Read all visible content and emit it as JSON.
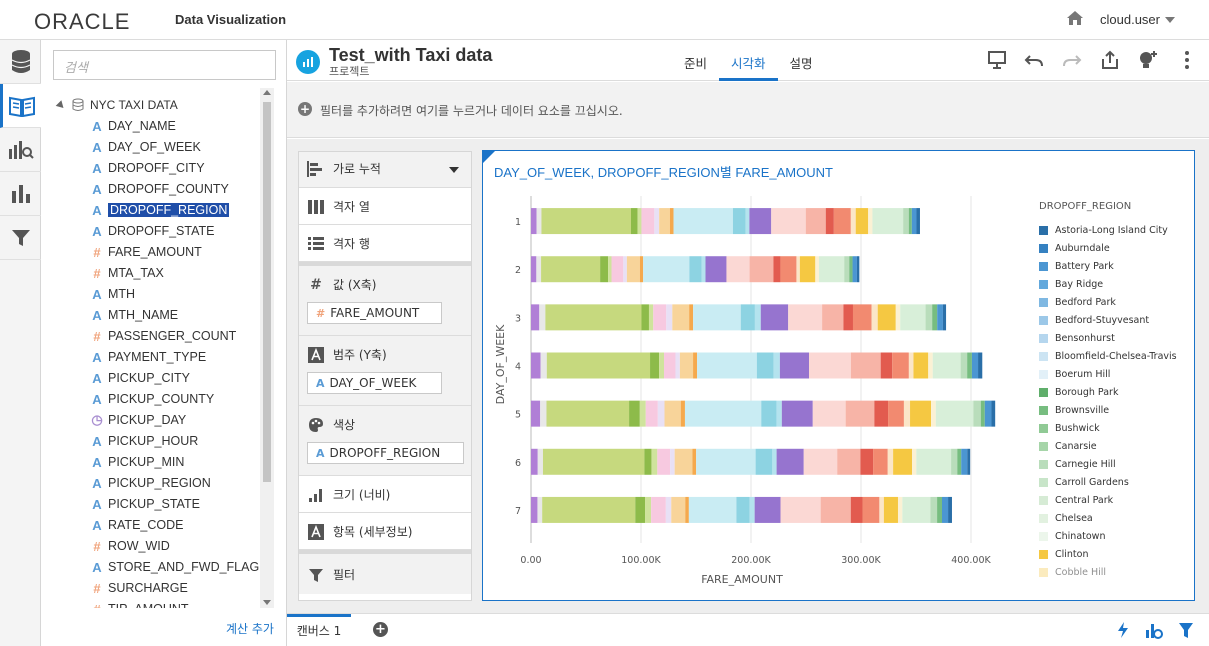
{
  "header": {
    "logo": "ORACLE",
    "app_title": "Data Visualization",
    "user_name": "cloud.user"
  },
  "data_panel": {
    "search_placeholder": "검색",
    "dataset_name": "NYC TAXI DATA",
    "items": [
      {
        "label": "DAY_NAME",
        "type": "A"
      },
      {
        "label": "DAY_OF_WEEK",
        "type": "A"
      },
      {
        "label": "DROPOFF_CITY",
        "type": "A"
      },
      {
        "label": "DROPOFF_COUNTY",
        "type": "A"
      },
      {
        "label": "DROPOFF_REGION",
        "type": "A"
      },
      {
        "label": "DROPOFF_STATE",
        "type": "A"
      },
      {
        "label": "FARE_AMOUNT",
        "type": "#"
      },
      {
        "label": "MTA_TAX",
        "type": "#"
      },
      {
        "label": "MTH",
        "type": "A"
      },
      {
        "label": "MTH_NAME",
        "type": "A"
      },
      {
        "label": "PASSENGER_COUNT",
        "type": "#"
      },
      {
        "label": "PAYMENT_TYPE",
        "type": "A"
      },
      {
        "label": "PICKUP_CITY",
        "type": "A"
      },
      {
        "label": "PICKUP_COUNTY",
        "type": "A"
      },
      {
        "label": "PICKUP_DAY",
        "type": "clock"
      },
      {
        "label": "PICKUP_HOUR",
        "type": "A"
      },
      {
        "label": "PICKUP_MIN",
        "type": "A"
      },
      {
        "label": "PICKUP_REGION",
        "type": "A"
      },
      {
        "label": "PICKUP_STATE",
        "type": "A"
      },
      {
        "label": "RATE_CODE",
        "type": "A"
      },
      {
        "label": "ROW_WID",
        "type": "#"
      },
      {
        "label": "STORE_AND_FWD_FLAG",
        "type": "A"
      },
      {
        "label": "SURCHARGE",
        "type": "#"
      },
      {
        "label": "TIP_AMOUNT",
        "type": "#"
      }
    ],
    "selected_item": "DROPOFF_REGION",
    "add_calc": "계산 추가"
  },
  "project": {
    "title": "Test_with Taxi data",
    "subtitle": "프로젝트",
    "tabs": [
      "준비",
      "시각화",
      "설명"
    ],
    "active_tab": "시각화"
  },
  "filter_bar": {
    "text": "필터를 추가하려면 여기를 누르거나 데이터 요소를 끄십시오."
  },
  "grammar": {
    "chart_type": "가로 누적",
    "grid_columns": "격자 열",
    "grid_rows": "격자 행",
    "values_label": "값 (X축)",
    "values_pill": "FARE_AMOUNT",
    "category_label": "범주 (Y축)",
    "category_pill": "DAY_OF_WEEK",
    "color_label": "색상",
    "color_pill": "DROPOFF_REGION",
    "size_label": "크기 (너비)",
    "detail_label": "항목 (세부정보)",
    "filter_label": "필터"
  },
  "bottom": {
    "canvas_tab": "캔버스 1"
  },
  "chart_data": {
    "type": "bar",
    "orientation": "horizontal",
    "stacked": true,
    "title": "DAY_OF_WEEK, DROPOFF_REGION별 FARE_AMOUNT",
    "xlabel": "FARE_AMOUNT",
    "ylabel": "DAY_OF_WEEK",
    "xlim": [
      0,
      420000
    ],
    "x_ticks": [
      "0.00",
      "100.00K",
      "200.00K",
      "300.00K",
      "400.00K"
    ],
    "categories": [
      "1",
      "2",
      "3",
      "4",
      "5",
      "6",
      "7"
    ],
    "totals": [
      332000,
      303000,
      383000,
      400000,
      427000,
      384000,
      382000
    ],
    "legend_title": "DROPOFF_REGION",
    "legend_position": "right",
    "legend_entries": [
      {
        "name": "Astoria-Long Island City",
        "color": "#2a6fa8"
      },
      {
        "name": "Auburndale",
        "color": "#3581c1"
      },
      {
        "name": "Battery Park",
        "color": "#4b96d2"
      },
      {
        "name": "Bay Ridge",
        "color": "#62a8dc"
      },
      {
        "name": "Bedford Park",
        "color": "#7fb8e2"
      },
      {
        "name": "Bedford-Stuyvesant",
        "color": "#9cc8e8"
      },
      {
        "name": "Bensonhurst",
        "color": "#b5d6ee"
      },
      {
        "name": "Bloomfield-Chelsea-Travis",
        "color": "#cce4f3"
      },
      {
        "name": "Boerum Hill",
        "color": "#e2f0f8"
      },
      {
        "name": "Borough Park",
        "color": "#5fae6b"
      },
      {
        "name": "Brownsville",
        "color": "#77bd80"
      },
      {
        "name": "Bushwick",
        "color": "#90ca95"
      },
      {
        "name": "Canarsie",
        "color": "#a6d5a9"
      },
      {
        "name": "Carnegie Hill",
        "color": "#b9ddbb"
      },
      {
        "name": "Carroll Gardens",
        "color": "#c8e5c9"
      },
      {
        "name": "Central Park",
        "color": "#d6ebd5"
      },
      {
        "name": "Chelsea",
        "color": "#e2f1e0"
      },
      {
        "name": "Chinatown",
        "color": "#ecf6eb"
      },
      {
        "name": "Clinton",
        "color": "#f5c842"
      },
      {
        "name": "Cobble Hill",
        "color": "#f9dc8a"
      }
    ],
    "segment_palette": [
      {
        "color": "#b07fd6",
        "frac": 0.018
      },
      {
        "color": "#e8e8e8",
        "frac": 0.012
      },
      {
        "color": "#c6d97e",
        "frac": 0.21
      },
      {
        "color": "#8dbb4a",
        "frac": 0.02
      },
      {
        "color": "#cfe39c",
        "frac": 0.012
      },
      {
        "color": "#f7c9e0",
        "frac": 0.03
      },
      {
        "color": "#e8e0f5",
        "frac": 0.012
      },
      {
        "color": "#f8d49a",
        "frac": 0.035
      },
      {
        "color": "#f5a94d",
        "frac": 0.01
      },
      {
        "color": "#c9ecf3",
        "frac": 0.135
      },
      {
        "color": "#8dd3e2",
        "frac": 0.035
      },
      {
        "color": "#b4e3ee",
        "frac": 0.012
      },
      {
        "color": "#9674cf",
        "frac": 0.055
      },
      {
        "color": "#fbd8d4",
        "frac": 0.08
      },
      {
        "color": "#f7b4a7",
        "frac": 0.06
      },
      {
        "color": "#e25b4f",
        "frac": 0.025
      },
      {
        "color": "#f28a70",
        "frac": 0.04
      },
      {
        "color": "#fbe6c8",
        "frac": 0.012
      },
      {
        "color": "#f5c842",
        "frac": 0.04
      },
      {
        "color": "#fbf1d4",
        "frac": 0.012
      },
      {
        "color": "#d8efd9",
        "frac": 0.07
      },
      {
        "color": "#b9ddbb",
        "frac": 0.015
      },
      {
        "color": "#77bd80",
        "frac": 0.01
      },
      {
        "color": "#4b96d2",
        "frac": 0.012
      },
      {
        "color": "#2a6fa8",
        "frac": 0.008
      }
    ]
  }
}
